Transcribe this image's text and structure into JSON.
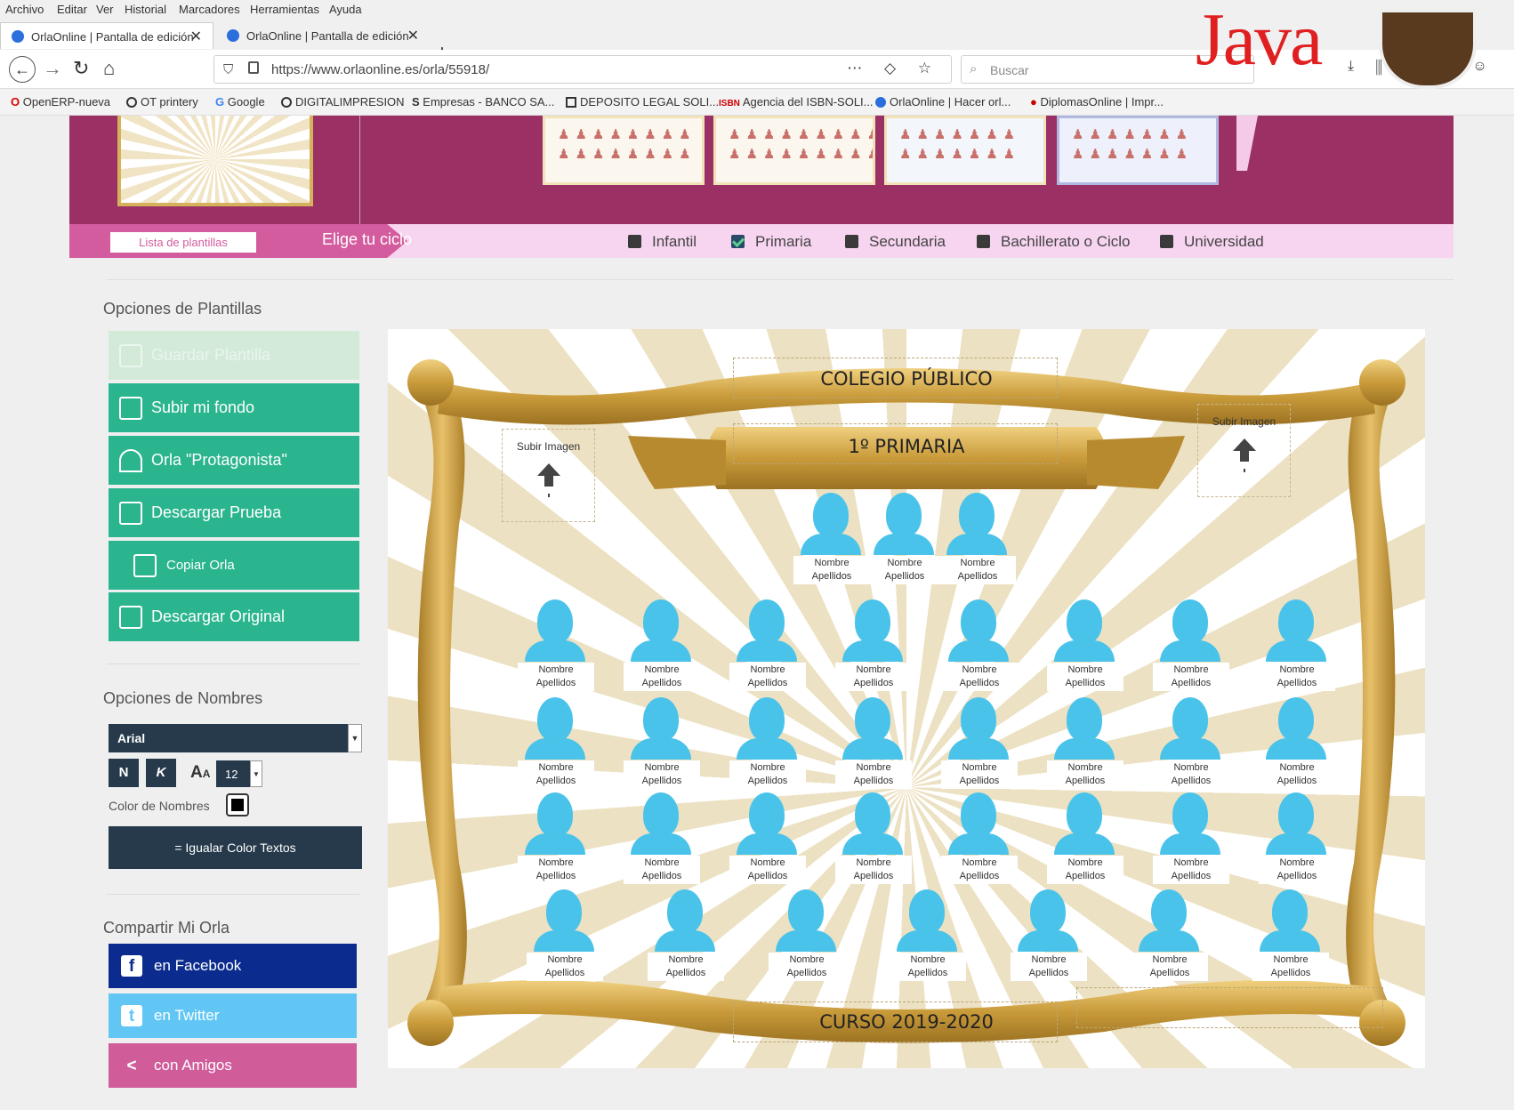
{
  "browser": {
    "menu": [
      "Archivo",
      "Editar",
      "Ver",
      "Historial",
      "Marcadores",
      "Herramientas",
      "Ayuda"
    ],
    "tabs": [
      {
        "title": "OrlaOnline | Pantalla de edición"
      },
      {
        "title": "OrlaOnline | Pantalla de edición"
      }
    ],
    "close_glyph": "✕",
    "new_tab": "+",
    "url": "https://www.orlaonline.es/orla/55918/",
    "search_placeholder": "Buscar",
    "java_logo_text": "Java",
    "bookmarks": [
      "OpenERP-nueva",
      "OT printery",
      "Google",
      "DIGITALIMPRESION",
      "Empresas - BANCO SA...",
      "DEPOSITO LEGAL SOLI...",
      "Agencia del ISBN-SOLI...",
      "OrlaOnline | Hacer orl...",
      "DiplomasOnline | Impr..."
    ]
  },
  "cycle_bar": {
    "list_button": "Lista de plantillas",
    "choose_label": "Elige tu ciclo",
    "options": [
      {
        "label": "Infantil",
        "checked": false
      },
      {
        "label": "Primaria",
        "checked": true
      },
      {
        "label": "Secundaria",
        "checked": false
      },
      {
        "label": "Bachillerato o Ciclo",
        "checked": false
      },
      {
        "label": "Universidad",
        "checked": false
      }
    ]
  },
  "sidebar": {
    "templates_title": "Opciones de Plantillas",
    "buttons": [
      {
        "label": "Guardar Plantilla",
        "icon": "save-icon",
        "enabled": false
      },
      {
        "label": "Subir mi fondo",
        "icon": "upload-image-icon",
        "enabled": true
      },
      {
        "label": "Orla \"Protagonista\"",
        "icon": "crown-person-icon",
        "enabled": true
      },
      {
        "label": "Descargar Prueba",
        "icon": "pdf-icon",
        "enabled": true
      },
      {
        "label": "Copiar Orla",
        "icon": "copy-icon",
        "enabled": true
      },
      {
        "label": "Descargar Original",
        "icon": "pdf-icon",
        "enabled": true
      }
    ],
    "names_title": "Opciones de Nombres",
    "font": "Arial",
    "bold_label": "N",
    "italic_label": "K",
    "font_size": "12",
    "color_label": "Color de Nombres",
    "name_color": "#000000",
    "equalize_label": "= Igualar Color Textos",
    "share_title": "Compartir Mi Orla",
    "share": [
      {
        "label": "en Facebook",
        "color": "#0b2c8e",
        "icon": "facebook-icon"
      },
      {
        "label": "en Twitter",
        "color": "#62c6f5",
        "icon": "twitter-icon"
      },
      {
        "label": "con Amigos",
        "color": "#d05c9a",
        "icon": "share-icon"
      }
    ]
  },
  "canvas": {
    "school": "COLEGIO PÚBLICO",
    "course": "1º PRIMARIA",
    "year": "CURSO 2019-2020",
    "upload_label": "Subir Imagen",
    "name_placeholder": "Nombre",
    "surname_placeholder": "Apellidos",
    "accent": "#4ac3ea"
  }
}
